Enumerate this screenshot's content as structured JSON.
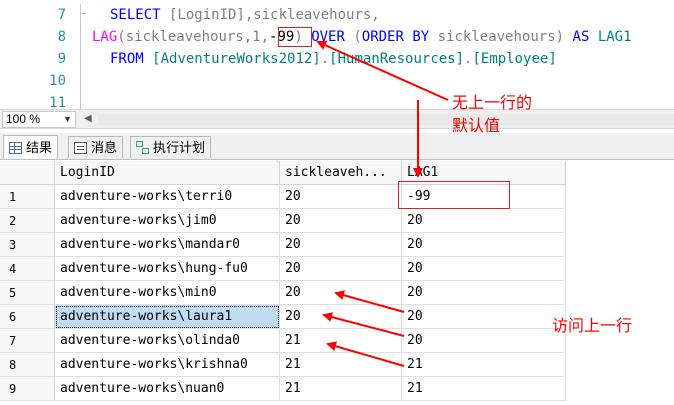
{
  "editor": {
    "line_numbers": [
      "7",
      "8",
      "9",
      "10",
      "11"
    ],
    "line7": {
      "kw_select": "SELECT",
      "rest": " [LoginID],sickleavehours,"
    },
    "line8": {
      "fn": "LAG",
      "p1": "(sickleavehours,1,",
      "default": "-99",
      "p2": ")",
      "kw_over": "OVER",
      "p3": " (",
      "kw_orderby": "ORDER BY",
      "p4": " sickleavehours",
      "p5": ")",
      "kw_as": "AS",
      "alias": "LAG1"
    },
    "line9": {
      "kw_from": "FROM",
      "db": "[AdventureWorks2012]",
      "dot1": ".",
      "schema": "[HumanResources]",
      "dot2": ".",
      "table": "[Employee]"
    }
  },
  "zoom": {
    "level": "100 %"
  },
  "tabs": [
    {
      "label": "结果",
      "icon": "results-grid-icon"
    },
    {
      "label": "消息",
      "icon": "messages-icon"
    },
    {
      "label": "执行计划",
      "icon": "execution-plan-icon"
    }
  ],
  "grid": {
    "columns": [
      "LoginID",
      "sickleaveh...",
      "LAG1"
    ],
    "rows": [
      {
        "n": "1",
        "login": "adventure-works\\terri0",
        "sick": "20",
        "lag": "-99"
      },
      {
        "n": "2",
        "login": "adventure-works\\jim0",
        "sick": "20",
        "lag": "20"
      },
      {
        "n": "3",
        "login": "adventure-works\\mandar0",
        "sick": "20",
        "lag": "20"
      },
      {
        "n": "4",
        "login": "adventure-works\\hung-fu0",
        "sick": "20",
        "lag": "20"
      },
      {
        "n": "5",
        "login": "adventure-works\\min0",
        "sick": "20",
        "lag": "20"
      },
      {
        "n": "6",
        "login": "adventure-works\\laura1",
        "sick": "20",
        "lag": "20"
      },
      {
        "n": "7",
        "login": "adventure-works\\olinda0",
        "sick": "21",
        "lag": "20"
      },
      {
        "n": "8",
        "login": "adventure-works\\krishna0",
        "sick": "21",
        "lag": "21"
      },
      {
        "n": "9",
        "login": "adventure-works\\nuan0",
        "sick": "21",
        "lag": "21"
      }
    ]
  },
  "annotations": {
    "no_prev_line1": "无上一行的",
    "no_prev_line2": "默认值",
    "access_prev": "访问上一行",
    "color": "#ff0000"
  }
}
